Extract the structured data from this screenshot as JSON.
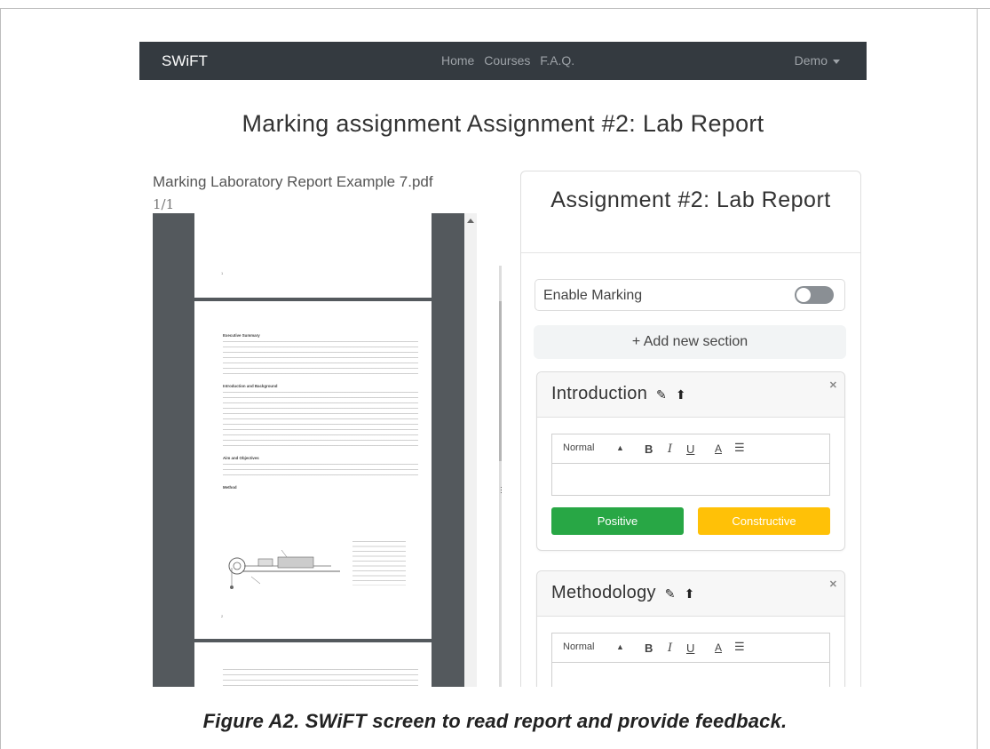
{
  "navbar": {
    "brand": "SWiFT",
    "links": [
      "Home",
      "Courses",
      "F.A.Q."
    ],
    "user": "Demo"
  },
  "page_title": "Marking assignment Assignment #2: Lab Report",
  "viewer": {
    "file_title": "Marking Laboratory Report Example 7.pdf",
    "page_count": "1/1"
  },
  "panel": {
    "title": "Assignment #2: Lab Report",
    "enable_marking_label": "Enable Marking",
    "enable_marking_on": false,
    "add_section_label": "+ Add new section",
    "sections": [
      {
        "title": "Introduction",
        "format_select": "Normal",
        "positive_label": "Positive",
        "constructive_label": "Constructive"
      },
      {
        "title": "Methodology",
        "format_select": "Normal"
      }
    ],
    "colors": {
      "positive": "#28a745",
      "constructive": "#ffc107",
      "navbar": "#343a40"
    }
  },
  "caption": "Figure A2. SWiFT screen to read report and provide feedback."
}
